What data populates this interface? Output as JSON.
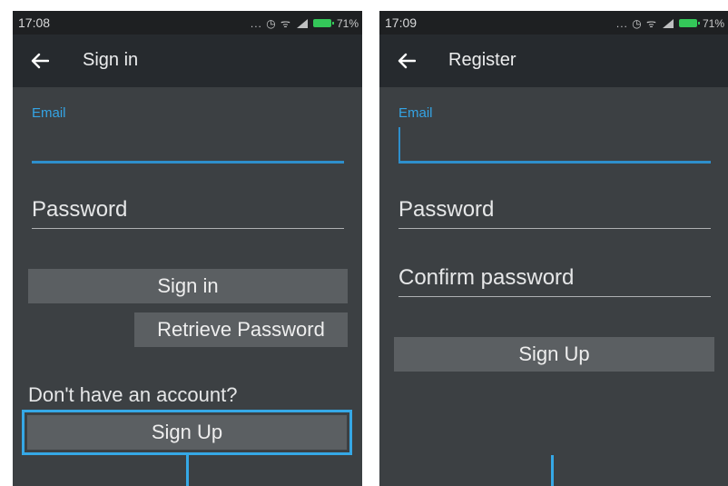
{
  "signin_screen": {
    "status_time": "17:08",
    "status_icons": "... ◷ ᯤ",
    "battery": "71%",
    "title": "Sign in",
    "email_label": "Email",
    "password_hint": "Password",
    "signin_button": "Sign in",
    "retrieve_button": "Retrieve Password",
    "no_account_text": "Don't have an account?",
    "signup_button": "Sign Up"
  },
  "register_screen": {
    "status_time": "17:09",
    "status_icons": "... ◷ ᯤ",
    "battery": "71%",
    "title": "Register",
    "email_label": "Email",
    "password_hint": "Password",
    "confirm_hint": "Confirm password",
    "signup_button": "Sign Up"
  },
  "colors": {
    "background": "#3c4043",
    "appbar": "#262a2e",
    "accent": "#35a8e6",
    "button": "#5b5f62"
  }
}
